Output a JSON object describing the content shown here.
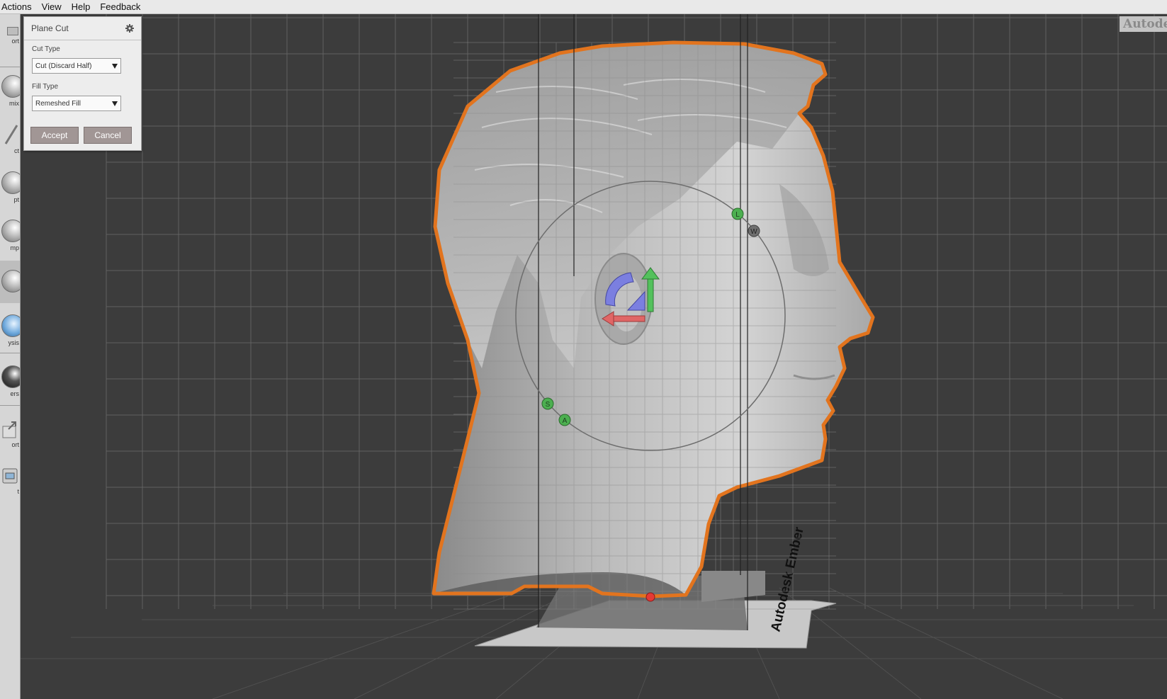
{
  "menubar": {
    "items": [
      "Actions",
      "View",
      "Help",
      "Feedback"
    ]
  },
  "toolbar": {
    "items": [
      {
        "label": "ort",
        "icon": "import-icon"
      },
      {
        "label": "mix",
        "icon": "meshmix-icon"
      },
      {
        "label": "ct",
        "icon": "select-icon"
      },
      {
        "label": "pt",
        "icon": "sculpt-icon"
      },
      {
        "label": "mp",
        "icon": "stamp-icon"
      },
      {
        "label": "",
        "icon": "edit-icon",
        "active": true
      },
      {
        "label": "ysis",
        "icon": "analysis-icon"
      },
      {
        "label": "ers",
        "icon": "shaders-icon"
      },
      {
        "label": "ort",
        "icon": "export-icon"
      },
      {
        "label": "t",
        "icon": "print-icon"
      }
    ]
  },
  "plane_cut": {
    "title": "Plane Cut",
    "cut_type_label": "Cut Type",
    "cut_type_value": "Cut (Discard Half)",
    "fill_type_label": "Fill Type",
    "fill_type_value": "Remeshed Fill",
    "accept_label": "Accept",
    "cancel_label": "Cancel"
  },
  "watermark": "Autodesk",
  "build_plate_text": "Autodesk Ember",
  "gizmo": {
    "handles": [
      "L",
      "W",
      "S",
      "A"
    ]
  },
  "colors": {
    "background": "#3c3c3c",
    "grid": "#6a6a6a",
    "outline": "#e2741e",
    "handle": "#4caf50",
    "gizmo_blue": "#7b7fe0",
    "gizmo_green": "#53c15c",
    "gizmo_red": "#e06666"
  }
}
